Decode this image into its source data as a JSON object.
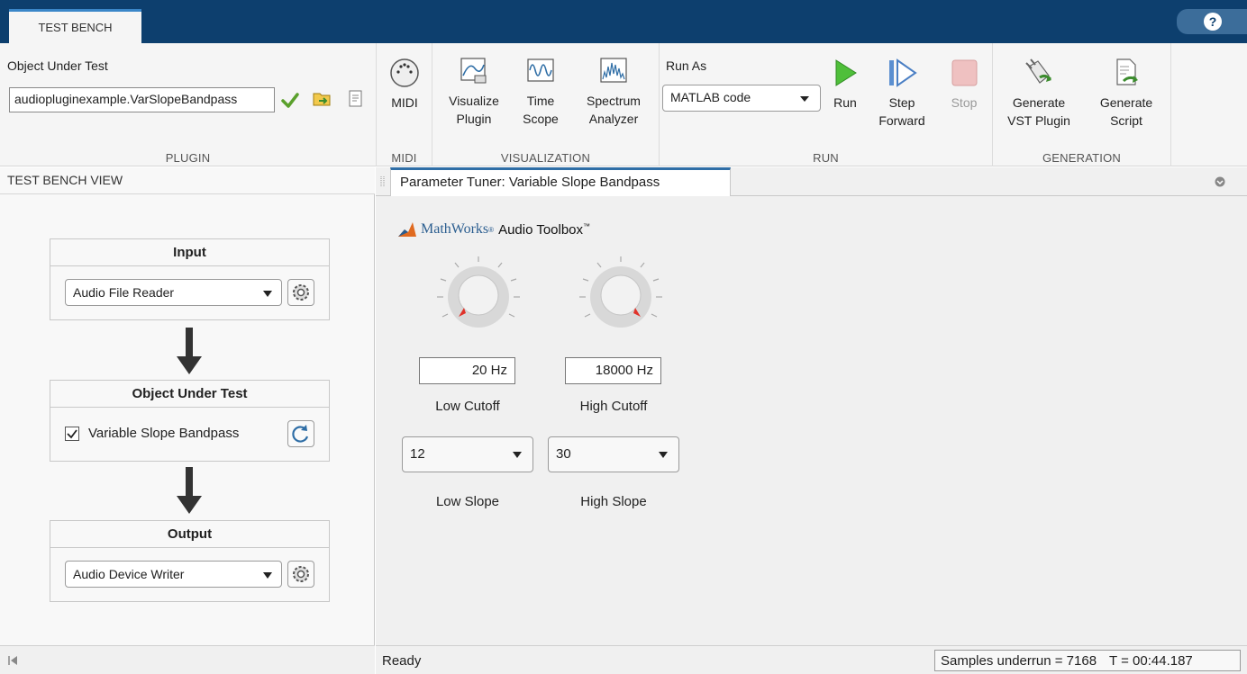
{
  "tabs": {
    "active": "TEST BENCH",
    "help": "?"
  },
  "toolstrip": {
    "plugin": {
      "label": "Object Under Test",
      "value": "audiopluginexample.VarSlopeBandpass",
      "section": "PLUGIN"
    },
    "midi": {
      "button": "MIDI",
      "section": "MIDI"
    },
    "visualization": {
      "visualize_plugin": [
        "Visualize",
        "Plugin"
      ],
      "time_scope": [
        "Time",
        "Scope"
      ],
      "spectrum_analyzer": [
        "Spectrum",
        "Analyzer"
      ],
      "section": "VISUALIZATION"
    },
    "run": {
      "run_as_label": "Run As",
      "run_as_value": "MATLAB code",
      "run": "Run",
      "step_forward": [
        "Step",
        "Forward"
      ],
      "stop": "Stop",
      "section": "RUN"
    },
    "generation": {
      "generate_vst": [
        "Generate",
        "VST Plugin"
      ],
      "generate_script": [
        "Generate",
        "Script"
      ],
      "section": "GENERATION"
    }
  },
  "left": {
    "header": "TEST BENCH VIEW",
    "input": {
      "title": "Input",
      "source": "Audio File Reader"
    },
    "object": {
      "title": "Object Under Test",
      "name": "Variable Slope Bandpass",
      "checked": true
    },
    "output": {
      "title": "Output",
      "sink": "Audio Device Writer"
    }
  },
  "right": {
    "tab": "Parameter Tuner: Variable Slope Bandpass",
    "logo": {
      "brand": "MathWorks",
      "product": "Audio Toolbox"
    },
    "params": {
      "low_cutoff": {
        "label": "Low Cutoff",
        "value": "20 Hz",
        "knob_level": 0.0
      },
      "high_cutoff": {
        "label": "High Cutoff",
        "value": "18000 Hz",
        "knob_level": 0.9
      },
      "low_slope": {
        "label": "Low Slope",
        "value": "12"
      },
      "high_slope": {
        "label": "High Slope",
        "value": "30"
      }
    }
  },
  "status": {
    "text": "Ready",
    "underrun": "Samples underrun = 7168",
    "time": "T = 00:44.187"
  },
  "colors": {
    "titlebar": "#0d3f6e",
    "accent": "#2f6ea6",
    "knob_indicator": "#e0322a"
  }
}
